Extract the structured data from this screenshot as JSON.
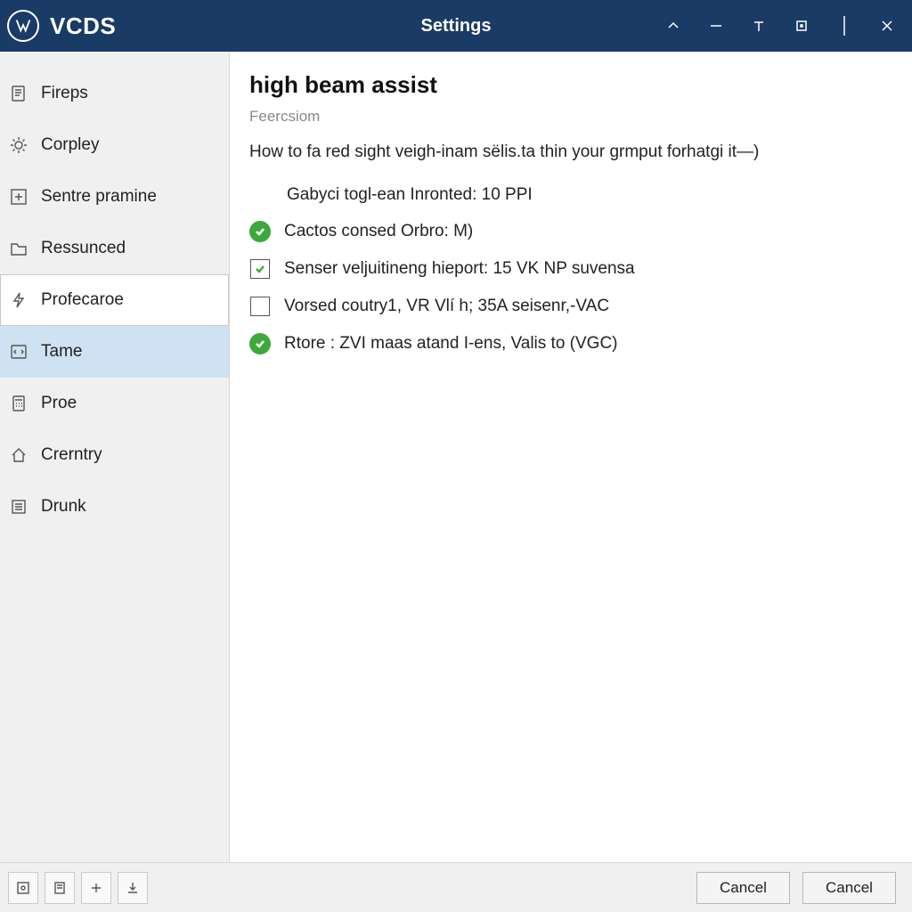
{
  "titlebar": {
    "appname": "VCDS",
    "center_title": "Settings",
    "logo_letter": "W"
  },
  "sidebar": {
    "items": [
      {
        "label": "Fireps"
      },
      {
        "label": "Corpley"
      },
      {
        "label": "Sentre pramine"
      },
      {
        "label": "Ressunced"
      },
      {
        "label": "Profecaroe"
      },
      {
        "label": "Tame"
      },
      {
        "label": "Proe"
      },
      {
        "label": "Crerntry"
      },
      {
        "label": "Drunk"
      }
    ]
  },
  "content": {
    "section_title": "high beam assist",
    "subtitle": "Feercsiom",
    "description": "How to fa red sight veigh-inam sëlis.ta thin your grmput forhatgi it—)",
    "settings": [
      {
        "label": "Gabyci togl-ean Inronted: 10 PPI"
      },
      {
        "label": "Cactos consed Orbro: M)"
      },
      {
        "label": "Senser veljuitineng hieport: 15 VK NP suvensa"
      },
      {
        "label": "Vorsed coutry1, VR Vlí h; 35A seisenr,-VAC"
      },
      {
        "label": "Rtore : ZVI maas atand I-ens, Valis to (VGC)"
      }
    ]
  },
  "footer": {
    "button1": "Cancel",
    "button2": "Cancel"
  }
}
